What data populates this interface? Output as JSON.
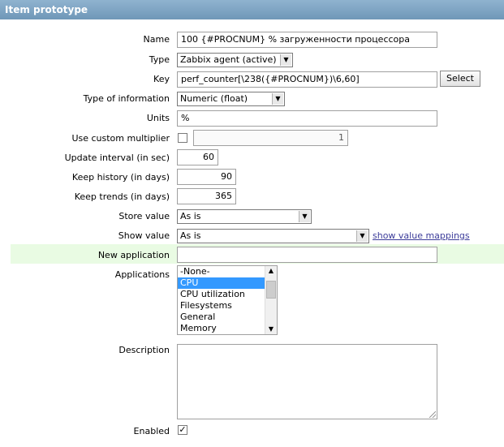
{
  "header": {
    "title": "Item prototype"
  },
  "form": {
    "name": {
      "label": "Name",
      "value": "100 {#PROCNUM} % загруженности процессора"
    },
    "type": {
      "label": "Type",
      "value": "Zabbix agent (active)"
    },
    "key": {
      "label": "Key",
      "value": "perf_counter[\\238({#PROCNUM})\\6,60]",
      "select_label": "Select"
    },
    "type_of_information": {
      "label": "Type of information",
      "value": "Numeric (float)"
    },
    "units": {
      "label": "Units",
      "value": "%"
    },
    "custom_multiplier": {
      "label": "Use custom multiplier",
      "checked": false,
      "value": "1"
    },
    "update_interval": {
      "label": "Update interval (in sec)",
      "value": "60"
    },
    "keep_history": {
      "label": "Keep history (in days)",
      "value": "90"
    },
    "keep_trends": {
      "label": "Keep trends (in days)",
      "value": "365"
    },
    "store_value": {
      "label": "Store value",
      "value": "As is"
    },
    "show_value": {
      "label": "Show value",
      "value": "As is",
      "link": "show value mappings"
    },
    "new_application": {
      "label": "New application",
      "value": ""
    },
    "applications": {
      "label": "Applications",
      "options": [
        "-None-",
        "CPU",
        "CPU utilization",
        "Filesystems",
        "General",
        "Memory"
      ],
      "selected": "CPU"
    },
    "description": {
      "label": "Description",
      "value": ""
    },
    "enabled": {
      "label": "Enabled",
      "checked": true,
      "check_glyph": "✓"
    }
  },
  "colors": {
    "header_bg": "#7fa3c2",
    "highlight_row": "#e9fbe3",
    "link": "#3c3c9a",
    "selected_option": "#3399ff"
  }
}
